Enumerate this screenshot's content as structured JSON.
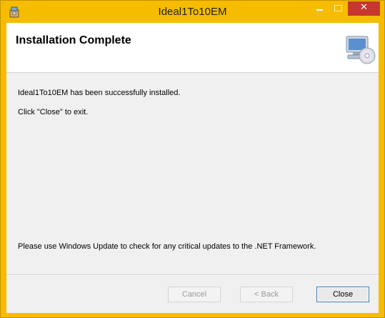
{
  "window": {
    "title": "Ideal1To10EM",
    "accent_color": "#f5bc00",
    "close_color": "#c7372f"
  },
  "header": {
    "title": "Installation Complete",
    "icon": "computer-cd-icon"
  },
  "content": {
    "line1": "Ideal1To10EM has been successfully installed.",
    "line2": "Click \"Close\" to exit.",
    "line3": "Please use Windows Update to check for any critical updates to the .NET Framework."
  },
  "buttons": {
    "cancel": "Cancel",
    "back": "< Back",
    "close": "Close"
  }
}
